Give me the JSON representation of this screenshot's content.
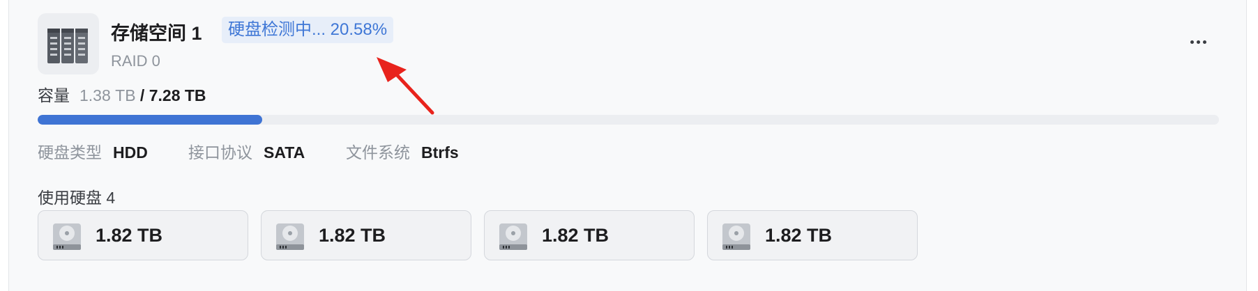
{
  "pool": {
    "icon": "server-rack-icon",
    "name": "存储空间 1",
    "status": "硬盘检测中... 20.58%",
    "raid": "RAID 0",
    "more_icon": "more-horizontal-icon"
  },
  "capacity": {
    "label": "容量",
    "used": "1.38 TB",
    "total": " / 7.28 TB",
    "used_fraction": 0.19
  },
  "specs": [
    {
      "key": "硬盘类型",
      "value": "HDD"
    },
    {
      "key": "接口协议",
      "value": "SATA"
    },
    {
      "key": "文件系统",
      "value": "Btrfs"
    }
  ],
  "disks": {
    "label": "使用硬盘 4",
    "icon": "hard-drive-icon",
    "items": [
      {
        "size": "1.82 TB"
      },
      {
        "size": "1.82 TB"
      },
      {
        "size": "1.82 TB"
      },
      {
        "size": "1.82 TB"
      }
    ]
  },
  "colors": {
    "accent": "#3f74d4",
    "annotation": "#e8231c"
  }
}
